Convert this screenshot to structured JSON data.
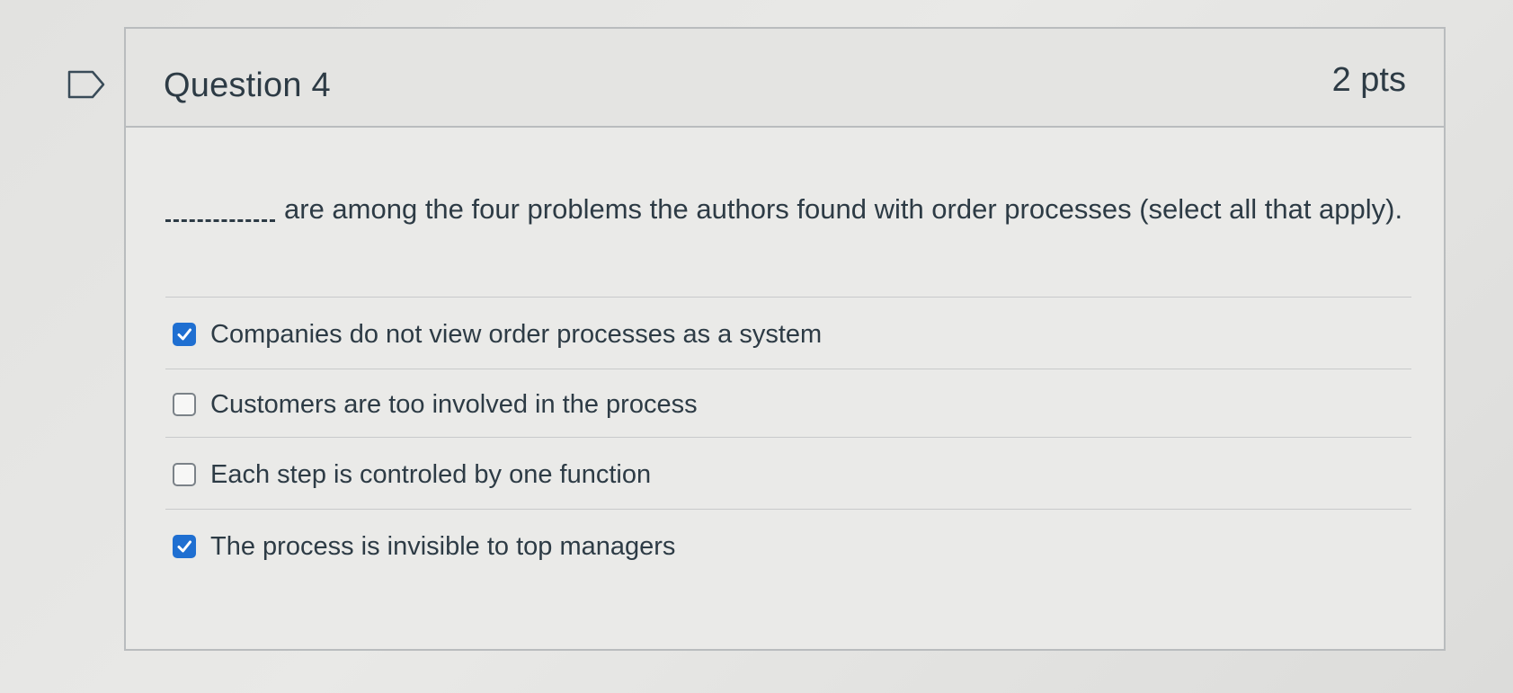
{
  "question": {
    "title": "Question 4",
    "points": "2 pts",
    "prompt_text": "are among the four problems the authors found with order processes (select all that apply)."
  },
  "answers": [
    {
      "label": "Companies do not view order processes as a system",
      "checked": true
    },
    {
      "label": "Customers are too involved in the process",
      "checked": false
    },
    {
      "label": "Each step is controled by one function",
      "checked": false
    },
    {
      "label": "The process is invisible to top managers",
      "checked": true
    }
  ],
  "colors": {
    "checkbox_checked": "#1f6fd1",
    "text": "#2d3b45",
    "border": "#b9bcbe"
  },
  "icons": {
    "flag": "flag-question-icon",
    "check": "checkmark-icon"
  }
}
